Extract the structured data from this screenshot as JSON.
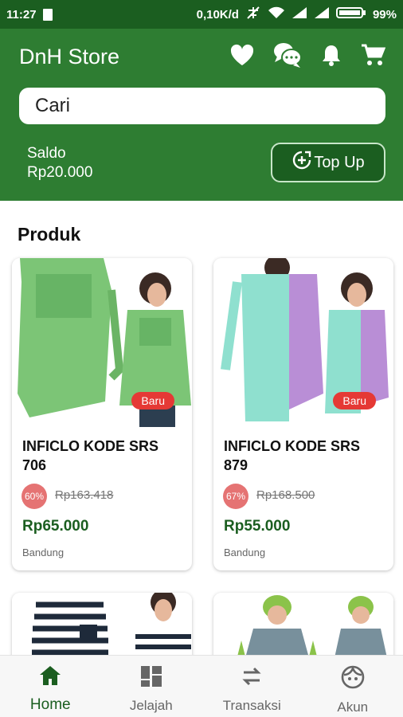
{
  "status_bar": {
    "time": "11:27",
    "speed": "0,10K/d",
    "battery": "99%"
  },
  "app": {
    "title": "DnH Store"
  },
  "header_icons": [
    "heart-icon",
    "chat-icon",
    "bell-icon",
    "cart-icon"
  ],
  "search": {
    "placeholder": "Cari"
  },
  "saldo": {
    "label": "Saldo",
    "value": "Rp20.000"
  },
  "topup": {
    "label": "Top Up"
  },
  "section": {
    "title": "Produk"
  },
  "products": [
    {
      "name": "INFICLO KODE SRS 706",
      "badge": "Baru",
      "discount": "60%",
      "old_price": "Rp163.418",
      "price": "Rp65.000",
      "location": "Bandung",
      "color": "#7cc576"
    },
    {
      "name": "INFICLO KODE SRS 879",
      "badge": "Baru",
      "discount": "67%",
      "old_price": "Rp168.500",
      "price": "Rp55.000",
      "location": "Bandung",
      "color": "#8fe0cf"
    }
  ],
  "nav": [
    {
      "label": "Home",
      "icon": "home-icon",
      "active": true
    },
    {
      "label": "Jelajah",
      "icon": "grid-icon",
      "active": false
    },
    {
      "label": "Transaksi",
      "icon": "swap-icon",
      "active": false
    },
    {
      "label": "Akun",
      "icon": "face-icon",
      "active": false
    }
  ],
  "colors": {
    "primary": "#2e7d32",
    "primary_dark": "#1b5e20",
    "badge": "#e53935"
  }
}
